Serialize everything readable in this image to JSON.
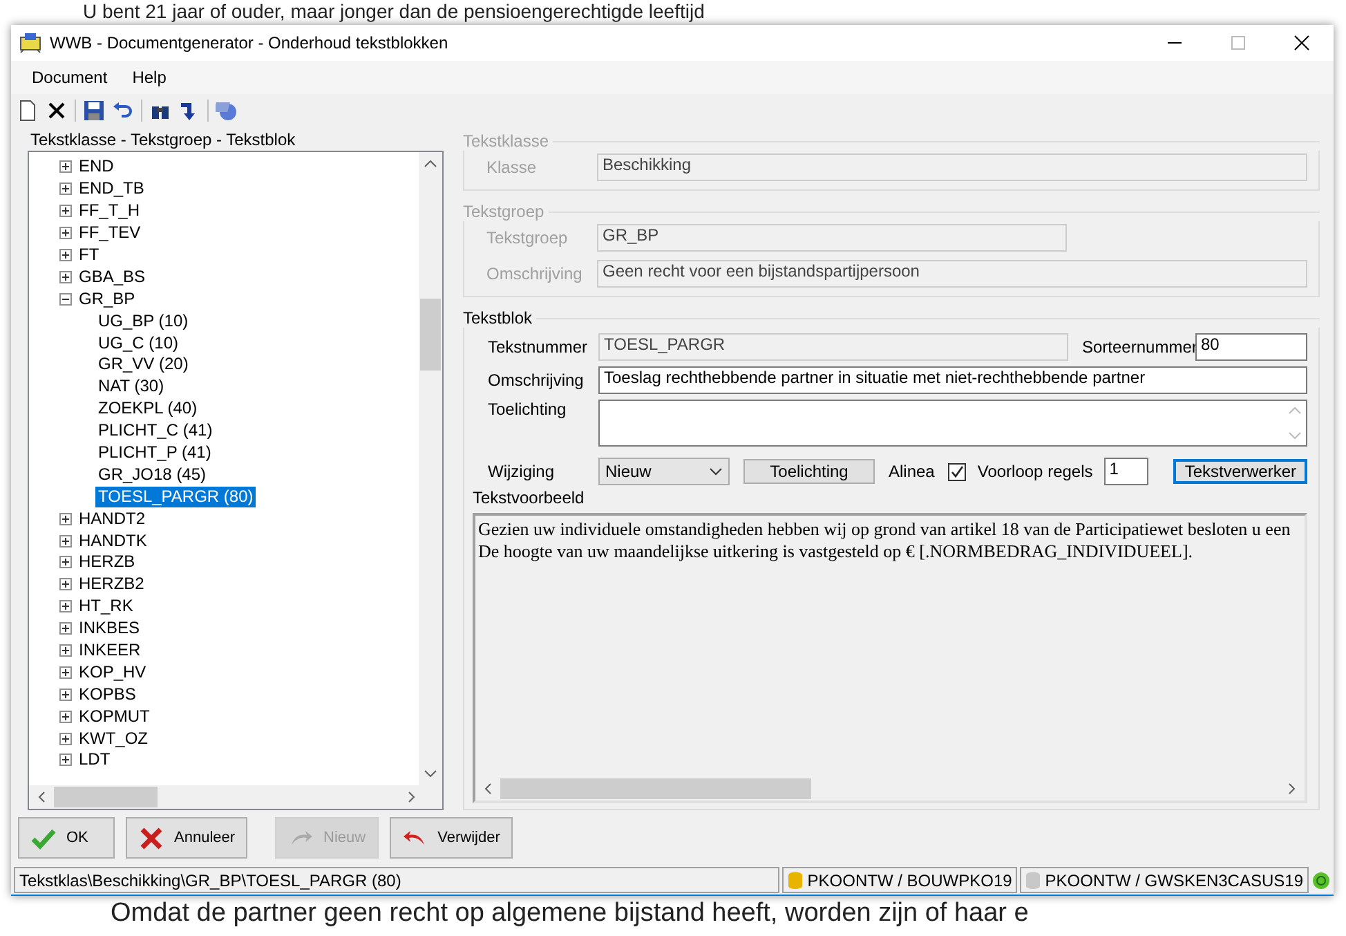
{
  "background_document": {
    "top_line": "U bent 21 jaar of ouder, maar jonger dan de pensioengerechtigde leeftijd",
    "bottom_line": "Omdat de partner geen recht op algemene bijstand heeft, worden zijn of haar e"
  },
  "window": {
    "title": "WWB - Documentgenerator - Onderhoud tekstblokken"
  },
  "menu": [
    "Document",
    "Help"
  ],
  "tree": {
    "title": "Tekstklasse - Tekstgroep - Tekstblok",
    "items": [
      {
        "label": "END",
        "expanded": false,
        "selected": false
      },
      {
        "label": "END_TB",
        "expanded": false,
        "selected": false
      },
      {
        "label": "FF_T_H",
        "expanded": false,
        "selected": false
      },
      {
        "label": "FF_TEV",
        "expanded": false,
        "selected": false
      },
      {
        "label": "FT",
        "expanded": false,
        "selected": false
      },
      {
        "label": "GBA_BS",
        "expanded": false,
        "selected": false
      },
      {
        "label": "GR_BP",
        "expanded": true,
        "selected": false,
        "children": [
          {
            "label": "UG_BP (10)",
            "selected": false
          },
          {
            "label": "UG_C (10)",
            "selected": false
          },
          {
            "label": "GR_VV (20)",
            "selected": false
          },
          {
            "label": "NAT (30)",
            "selected": false
          },
          {
            "label": "ZOEKPL (40)",
            "selected": false
          },
          {
            "label": "PLICHT_C (41)",
            "selected": false
          },
          {
            "label": "PLICHT_P (41)",
            "selected": false
          },
          {
            "label": "GR_JO18 (45)",
            "selected": false
          },
          {
            "label": "TOESL_PARGR (80)",
            "selected": true
          }
        ]
      },
      {
        "label": "HANDT2",
        "expanded": false,
        "selected": false
      },
      {
        "label": "HANDTK",
        "expanded": false,
        "selected": false
      },
      {
        "label": "HERZB",
        "expanded": false,
        "selected": false
      },
      {
        "label": "HERZB2",
        "expanded": false,
        "selected": false
      },
      {
        "label": "HT_RK",
        "expanded": false,
        "selected": false
      },
      {
        "label": "INKBES",
        "expanded": false,
        "selected": false
      },
      {
        "label": "INKEER",
        "expanded": false,
        "selected": false
      },
      {
        "label": "KOP_HV",
        "expanded": false,
        "selected": false
      },
      {
        "label": "KOPBS",
        "expanded": false,
        "selected": false
      },
      {
        "label": "KOPMUT",
        "expanded": false,
        "selected": false
      },
      {
        "label": "KWT_OZ",
        "expanded": false,
        "selected": false
      },
      {
        "label": "LDT",
        "expanded": false,
        "selected": false
      }
    ]
  },
  "tekstklasse": {
    "title": "Tekstklasse",
    "disabled": true,
    "fields": [
      {
        "label": "Klasse",
        "value": "Beschikking",
        "wide": true
      }
    ]
  },
  "tekstgroep": {
    "title": "Tekstgroep",
    "disabled": true,
    "fields": [
      {
        "label": "Tekstgroep",
        "value": "GR_BP",
        "wide": false
      },
      {
        "label": "Omschrijving",
        "value": "Geen recht voor een bijstandspartijpersoon",
        "wide": true
      }
    ]
  },
  "tekstblok": {
    "title": "Tekstblok",
    "disabled": false,
    "tekstnummer": {
      "label": "Tekstnummer",
      "value": "TOESL_PARGR",
      "disabled": true
    },
    "sorteernummer": {
      "label": "Sorteernummer",
      "value": "80"
    },
    "omschrijving": {
      "label": "Omschrijving",
      "value": "Toeslag rechthebbende partner in situatie met niet-rechthebbende partner"
    },
    "toelichting": {
      "label": "Toelichting"
    },
    "wijziging": {
      "label": "Wijziging",
      "value": "Nieuw"
    },
    "toelichting_button": "Toelichting",
    "alinea": {
      "label": "Alinea",
      "checked": true
    },
    "voorloop_regels": {
      "label": "Voorloop regels",
      "value": "1"
    },
    "tekstverwerker_button": "Tekstverwerker",
    "preview": {
      "label": "Tekstvoorbeeld",
      "lines": [
        "Gezien uw  individuele omstandigheden hebben wij op grond van artikel 18 van de Participatiewet besloten u een",
        "De hoogte van uw maandelijkse uitkering is vastgesteld op € [.NORMBEDRAG_INDIVIDUEEL]."
      ]
    }
  },
  "buttons": [
    {
      "label": "OK",
      "kind": "ok",
      "disabled": false
    },
    {
      "label": "Annuleer",
      "kind": "cancel",
      "disabled": false
    },
    {
      "label": "Nieuw",
      "kind": "new",
      "disabled": true
    },
    {
      "label": "Verwijder",
      "kind": "delete",
      "disabled": false
    }
  ],
  "status_bar": {
    "path": "Tekstklas\\Beschikking\\GR_BP\\TOESL_PARGR (80)",
    "connections": [
      {
        "label": "PKOONTW / BOUWPKO19",
        "color": "#e8b400"
      },
      {
        "label": "PKOONTW / GWSKEN3CASUS19",
        "color": "#c8c8c8"
      }
    ]
  }
}
